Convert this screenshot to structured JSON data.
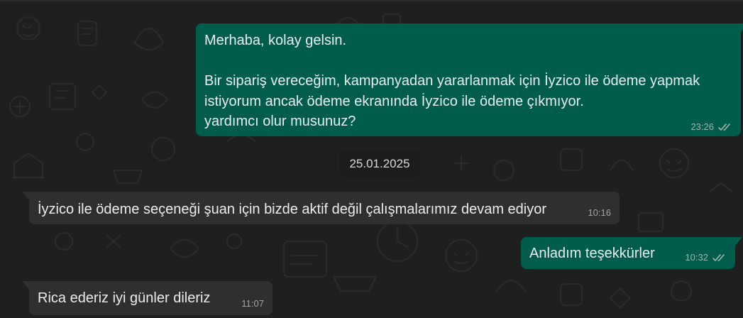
{
  "chat": {
    "messages": [
      {
        "direction": "outgoing",
        "text": "Merhaba, kolay gelsin.\n\nBir sipariş vereceğim, kampanyadan yararlanmak için İyzico ile ödeme yapmak istiyorum ancak ödeme ekranında İyzico ile ödeme çıkmıyor.\nyardımcı olur musunuz?",
        "time": "23:26",
        "status": "read-double-tick-icon"
      },
      {
        "direction": "incoming",
        "text": "İyzico ile ödeme seçeneği şuan için bizde aktif değil çalışmalarımız devam ediyor",
        "time": "10:16"
      },
      {
        "direction": "outgoing",
        "text": "Anladım teşekkürler",
        "time": "10:32",
        "status": "read-double-tick-icon"
      },
      {
        "direction": "incoming",
        "text": "Rica ederiz iyi günler dileriz",
        "time": "11:07"
      }
    ],
    "date_separator": "25.01.2025"
  },
  "colors": {
    "background": "#1f1f1f",
    "outgoing_bubble": "#005c4b",
    "incoming_bubble": "#2e2f2f",
    "date_chip": "#1c1c1c"
  }
}
